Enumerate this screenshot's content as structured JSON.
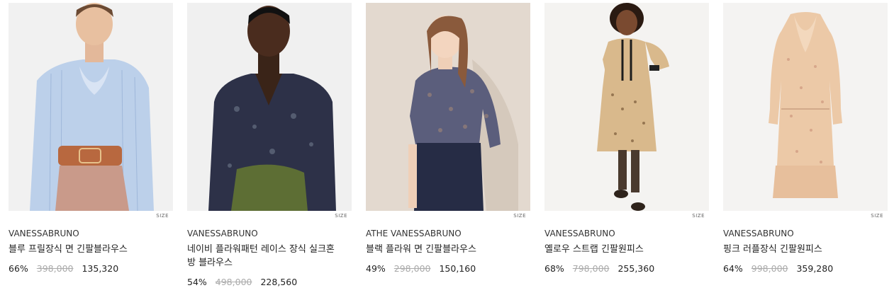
{
  "products": [
    {
      "brand": "VANESSABRUNO",
      "name": "블루 프릴장식 면 긴팔블라우스",
      "discount": "66%",
      "original_price": "398,000",
      "sale_price": "135,320",
      "size_label": "SIZE"
    },
    {
      "brand": "VANESSABRUNO",
      "name": "네이비 플라워패턴 레이스 장식 실크혼방 블라우스",
      "discount": "54%",
      "original_price": "498,000",
      "sale_price": "228,560",
      "size_label": "SIZE"
    },
    {
      "brand": "ATHE VANESSABRUNO",
      "name": "블랙 플라워 면 긴팔블라우스",
      "discount": "49%",
      "original_price": "298,000",
      "sale_price": "150,160",
      "size_label": "SIZE"
    },
    {
      "brand": "VANESSABRUNO",
      "name": "옐로우 스트랩 긴팔원피스",
      "discount": "68%",
      "original_price": "798,000",
      "sale_price": "255,360",
      "size_label": "SIZE"
    },
    {
      "brand": "VANESSABRUNO",
      "name": "핑크 러플장식 긴팔원피스",
      "discount": "64%",
      "original_price": "998,000",
      "sale_price": "359,280",
      "size_label": "SIZE"
    }
  ]
}
